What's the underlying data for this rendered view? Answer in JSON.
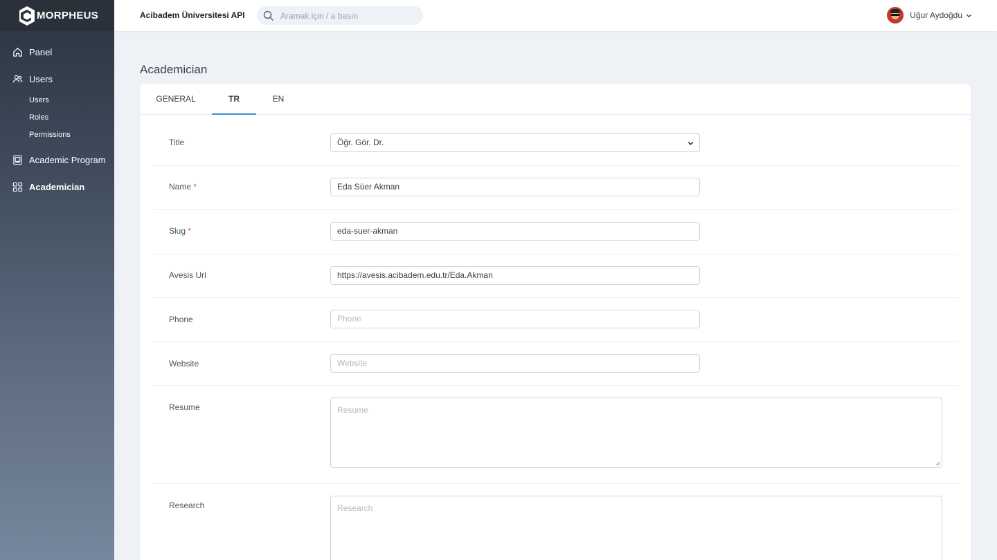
{
  "brand": {
    "name": "MORPHEUS"
  },
  "sidebar": {
    "items": [
      {
        "label": "Panel",
        "icon": "home-icon"
      },
      {
        "label": "Users",
        "icon": "users-icon",
        "children": [
          "Users",
          "Roles",
          "Permissions"
        ]
      },
      {
        "label": "Academic Program",
        "icon": "book-icon"
      },
      {
        "label": "Academician",
        "icon": "grid-icon",
        "active": true
      }
    ]
  },
  "topbar": {
    "app_title": "Acibadem Üniversitesi API",
    "search_placeholder": "Aramak için / a basın",
    "user_name": "Uğur Aydoğdu"
  },
  "page": {
    "title": "Academician"
  },
  "tabs": [
    {
      "label": "GENERAL",
      "active": false
    },
    {
      "label": "TR",
      "active": true
    },
    {
      "label": "EN",
      "active": false
    }
  ],
  "form": {
    "title": {
      "label": "Title",
      "value": "Öğr. Gör. Dr."
    },
    "name": {
      "label": "Name",
      "required_mark": "*",
      "value": "Eda Süer Akman"
    },
    "slug": {
      "label": "Slug",
      "required_mark": "*",
      "value": "eda-suer-akman"
    },
    "avesis": {
      "label": "Avesis Url",
      "value": "https://avesis.acibadem.edu.tr/Eda.Akman"
    },
    "phone": {
      "label": "Phone",
      "placeholder": "Phone"
    },
    "website": {
      "label": "Website",
      "placeholder": "Website"
    },
    "resume": {
      "label": "Resume",
      "placeholder": "Resume"
    },
    "research": {
      "label": "Research",
      "placeholder": "Research"
    }
  },
  "colors": {
    "accent": "#3b8ed8",
    "required": "#e55353",
    "sidebar_top": "#2b3440",
    "sidebar_bottom": "#76869c"
  }
}
